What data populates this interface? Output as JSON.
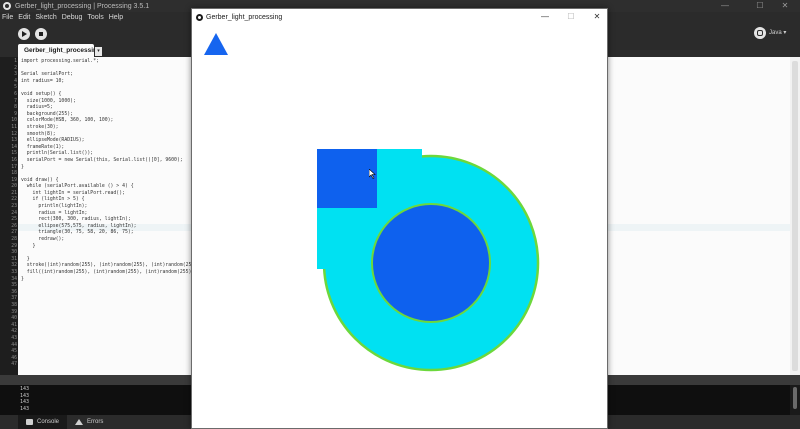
{
  "ide": {
    "title": "Gerber_light_processing | Processing 3.5.1",
    "window_controls": {
      "minimize": "—",
      "maximize": "☐",
      "close": "✕"
    },
    "menu": [
      "File",
      "Edit",
      "Sketch",
      "Debug",
      "Tools",
      "Help"
    ],
    "toolbar": {
      "run_icon": "play-icon",
      "stop_icon": "stop-icon",
      "debug_icon": "bug-icon",
      "mode": "Java ▾"
    },
    "tab": {
      "label": "Gerber_light_processing",
      "dropdown": "▾"
    }
  },
  "editor": {
    "line_numbers": [
      "1",
      "2",
      "3",
      "4",
      "5",
      "6",
      "7",
      "8",
      "9",
      "10",
      "11",
      "12",
      "13",
      "14",
      "15",
      "16",
      "17",
      "18",
      "19",
      "20",
      "21",
      "22",
      "23",
      "24",
      "25",
      "26",
      "27",
      "28",
      "29",
      "30",
      "31",
      "32",
      "33",
      "34",
      "35",
      "36",
      "37",
      "38",
      "39",
      "40",
      "41",
      "42",
      "43",
      "44",
      "45",
      "46",
      "47"
    ],
    "code": [
      "import processing.serial.*;",
      "",
      "Serial serialPort;",
      "int radius= 10;",
      "",
      "void setup() {",
      "  size(1000, 1000);",
      "  radius=5;",
      "  background(255);",
      "  colorMode(HSB, 360, 100, 100);",
      "  stroke(30);",
      "  smooth(8);",
      "  ellipseMode(RADIUS);",
      "  frameRate(1);",
      "  println(Serial.list());",
      "  serialPort = new Serial(this, Serial.list()[0], 9600);",
      "}",
      "",
      "void draw() {",
      "  while (serialPort.available () > 4) {",
      "    int lightIn = serialPort.read();",
      "    if (lightIn > 5) {",
      "      println(lightIn);",
      "      radius = lightIn;",
      "      rect(300, 300, radius, lightIn);",
      "      ellipse(575,575, radius, lightIn);",
      "      triangle(30, 75, 58, 20, 86, 75);",
      "      redraw();",
      "    }",
      "",
      "  }",
      "  stroke((int)random(255), (int)random(255), (int)random(255));",
      "  fill((int)random(255), (int)random(255), (int)random(255));",
      "}"
    ]
  },
  "console": {
    "lines": [
      "143",
      "143",
      "143",
      "143"
    ],
    "tabs": {
      "console": "Console",
      "errors": "Errors"
    }
  },
  "sketch": {
    "title": "Gerber_light_processing",
    "window_controls": {
      "minimize": "—",
      "maximize": "☐",
      "close": "✕"
    },
    "colors": {
      "background": "#ffffff",
      "cyan_fill": "#00e1f2",
      "cyan_stroke": "#6cd83c",
      "blue_fill": "#0e61ee",
      "triangle": "#1665ef",
      "rect_fill": "#0e61ee"
    }
  }
}
